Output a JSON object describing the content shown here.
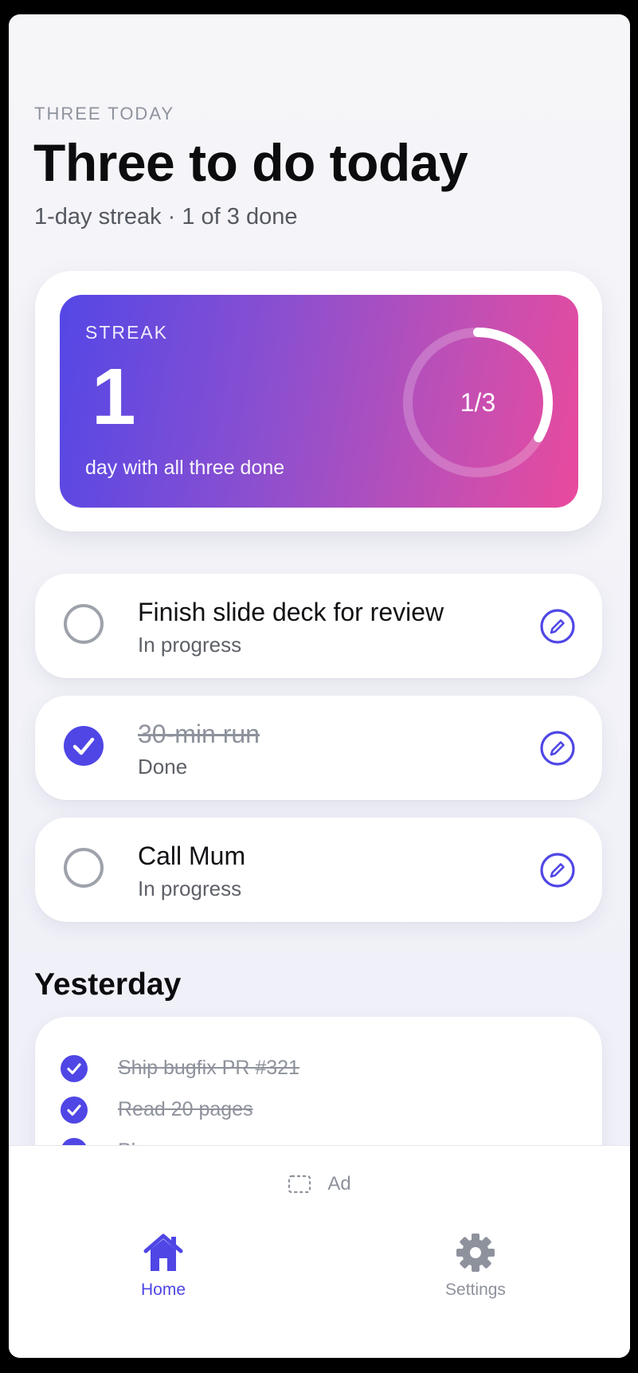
{
  "header": {
    "eyebrow": "THREE TODAY",
    "title": "Three to do today",
    "subtitle": "1-day streak · 1 of 3 done"
  },
  "streak": {
    "label": "STREAK",
    "count": "1",
    "caption": "day with all three done",
    "progress_text": "1/3",
    "progress_done": 1,
    "progress_total": 3
  },
  "tasks": [
    {
      "title": "Finish slide deck for review",
      "status": "In progress",
      "done": false
    },
    {
      "title": "30-min run",
      "status": "Done",
      "done": true
    },
    {
      "title": "Call Mum",
      "status": "In progress",
      "done": false
    }
  ],
  "yesterday": {
    "heading": "Yesterday",
    "items": [
      "Ship bugfix PR #321",
      "Read 20 pages",
      "Plan grocery run"
    ]
  },
  "ad": {
    "label": "Ad"
  },
  "tabs": [
    {
      "label": "Home",
      "icon": "home-icon",
      "active": true
    },
    {
      "label": "Settings",
      "icon": "gear-icon",
      "active": false
    }
  ],
  "colors": {
    "accent": "#4f46e5",
    "gradient_start": "#5447e6",
    "gradient_end": "#e94a9d",
    "muted": "#8e929c"
  }
}
